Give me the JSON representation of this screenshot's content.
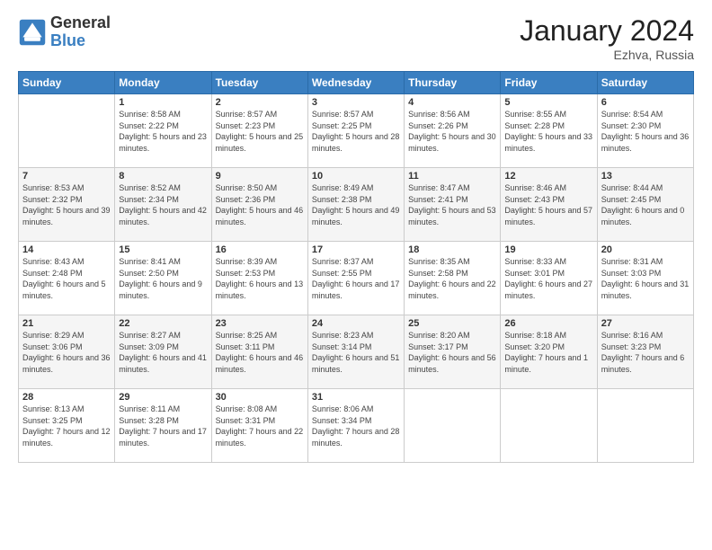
{
  "header": {
    "logo_general": "General",
    "logo_blue": "Blue",
    "title": "January 2024",
    "location": "Ezhva, Russia"
  },
  "days_of_week": [
    "Sunday",
    "Monday",
    "Tuesday",
    "Wednesday",
    "Thursday",
    "Friday",
    "Saturday"
  ],
  "weeks": [
    [
      {
        "day": "",
        "sunrise": "",
        "sunset": "",
        "daylight": ""
      },
      {
        "day": "1",
        "sunrise": "Sunrise: 8:58 AM",
        "sunset": "Sunset: 2:22 PM",
        "daylight": "Daylight: 5 hours and 23 minutes."
      },
      {
        "day": "2",
        "sunrise": "Sunrise: 8:57 AM",
        "sunset": "Sunset: 2:23 PM",
        "daylight": "Daylight: 5 hours and 25 minutes."
      },
      {
        "day": "3",
        "sunrise": "Sunrise: 8:57 AM",
        "sunset": "Sunset: 2:25 PM",
        "daylight": "Daylight: 5 hours and 28 minutes."
      },
      {
        "day": "4",
        "sunrise": "Sunrise: 8:56 AM",
        "sunset": "Sunset: 2:26 PM",
        "daylight": "Daylight: 5 hours and 30 minutes."
      },
      {
        "day": "5",
        "sunrise": "Sunrise: 8:55 AM",
        "sunset": "Sunset: 2:28 PM",
        "daylight": "Daylight: 5 hours and 33 minutes."
      },
      {
        "day": "6",
        "sunrise": "Sunrise: 8:54 AM",
        "sunset": "Sunset: 2:30 PM",
        "daylight": "Daylight: 5 hours and 36 minutes."
      }
    ],
    [
      {
        "day": "7",
        "sunrise": "Sunrise: 8:53 AM",
        "sunset": "Sunset: 2:32 PM",
        "daylight": "Daylight: 5 hours and 39 minutes."
      },
      {
        "day": "8",
        "sunrise": "Sunrise: 8:52 AM",
        "sunset": "Sunset: 2:34 PM",
        "daylight": "Daylight: 5 hours and 42 minutes."
      },
      {
        "day": "9",
        "sunrise": "Sunrise: 8:50 AM",
        "sunset": "Sunset: 2:36 PM",
        "daylight": "Daylight: 5 hours and 46 minutes."
      },
      {
        "day": "10",
        "sunrise": "Sunrise: 8:49 AM",
        "sunset": "Sunset: 2:38 PM",
        "daylight": "Daylight: 5 hours and 49 minutes."
      },
      {
        "day": "11",
        "sunrise": "Sunrise: 8:47 AM",
        "sunset": "Sunset: 2:41 PM",
        "daylight": "Daylight: 5 hours and 53 minutes."
      },
      {
        "day": "12",
        "sunrise": "Sunrise: 8:46 AM",
        "sunset": "Sunset: 2:43 PM",
        "daylight": "Daylight: 5 hours and 57 minutes."
      },
      {
        "day": "13",
        "sunrise": "Sunrise: 8:44 AM",
        "sunset": "Sunset: 2:45 PM",
        "daylight": "Daylight: 6 hours and 0 minutes."
      }
    ],
    [
      {
        "day": "14",
        "sunrise": "Sunrise: 8:43 AM",
        "sunset": "Sunset: 2:48 PM",
        "daylight": "Daylight: 6 hours and 5 minutes."
      },
      {
        "day": "15",
        "sunrise": "Sunrise: 8:41 AM",
        "sunset": "Sunset: 2:50 PM",
        "daylight": "Daylight: 6 hours and 9 minutes."
      },
      {
        "day": "16",
        "sunrise": "Sunrise: 8:39 AM",
        "sunset": "Sunset: 2:53 PM",
        "daylight": "Daylight: 6 hours and 13 minutes."
      },
      {
        "day": "17",
        "sunrise": "Sunrise: 8:37 AM",
        "sunset": "Sunset: 2:55 PM",
        "daylight": "Daylight: 6 hours and 17 minutes."
      },
      {
        "day": "18",
        "sunrise": "Sunrise: 8:35 AM",
        "sunset": "Sunset: 2:58 PM",
        "daylight": "Daylight: 6 hours and 22 minutes."
      },
      {
        "day": "19",
        "sunrise": "Sunrise: 8:33 AM",
        "sunset": "Sunset: 3:01 PM",
        "daylight": "Daylight: 6 hours and 27 minutes."
      },
      {
        "day": "20",
        "sunrise": "Sunrise: 8:31 AM",
        "sunset": "Sunset: 3:03 PM",
        "daylight": "Daylight: 6 hours and 31 minutes."
      }
    ],
    [
      {
        "day": "21",
        "sunrise": "Sunrise: 8:29 AM",
        "sunset": "Sunset: 3:06 PM",
        "daylight": "Daylight: 6 hours and 36 minutes."
      },
      {
        "day": "22",
        "sunrise": "Sunrise: 8:27 AM",
        "sunset": "Sunset: 3:09 PM",
        "daylight": "Daylight: 6 hours and 41 minutes."
      },
      {
        "day": "23",
        "sunrise": "Sunrise: 8:25 AM",
        "sunset": "Sunset: 3:11 PM",
        "daylight": "Daylight: 6 hours and 46 minutes."
      },
      {
        "day": "24",
        "sunrise": "Sunrise: 8:23 AM",
        "sunset": "Sunset: 3:14 PM",
        "daylight": "Daylight: 6 hours and 51 minutes."
      },
      {
        "day": "25",
        "sunrise": "Sunrise: 8:20 AM",
        "sunset": "Sunset: 3:17 PM",
        "daylight": "Daylight: 6 hours and 56 minutes."
      },
      {
        "day": "26",
        "sunrise": "Sunrise: 8:18 AM",
        "sunset": "Sunset: 3:20 PM",
        "daylight": "Daylight: 7 hours and 1 minute."
      },
      {
        "day": "27",
        "sunrise": "Sunrise: 8:16 AM",
        "sunset": "Sunset: 3:23 PM",
        "daylight": "Daylight: 7 hours and 6 minutes."
      }
    ],
    [
      {
        "day": "28",
        "sunrise": "Sunrise: 8:13 AM",
        "sunset": "Sunset: 3:25 PM",
        "daylight": "Daylight: 7 hours and 12 minutes."
      },
      {
        "day": "29",
        "sunrise": "Sunrise: 8:11 AM",
        "sunset": "Sunset: 3:28 PM",
        "daylight": "Daylight: 7 hours and 17 minutes."
      },
      {
        "day": "30",
        "sunrise": "Sunrise: 8:08 AM",
        "sunset": "Sunset: 3:31 PM",
        "daylight": "Daylight: 7 hours and 22 minutes."
      },
      {
        "day": "31",
        "sunrise": "Sunrise: 8:06 AM",
        "sunset": "Sunset: 3:34 PM",
        "daylight": "Daylight: 7 hours and 28 minutes."
      },
      {
        "day": "",
        "sunrise": "",
        "sunset": "",
        "daylight": ""
      },
      {
        "day": "",
        "sunrise": "",
        "sunset": "",
        "daylight": ""
      },
      {
        "day": "",
        "sunrise": "",
        "sunset": "",
        "daylight": ""
      }
    ]
  ]
}
